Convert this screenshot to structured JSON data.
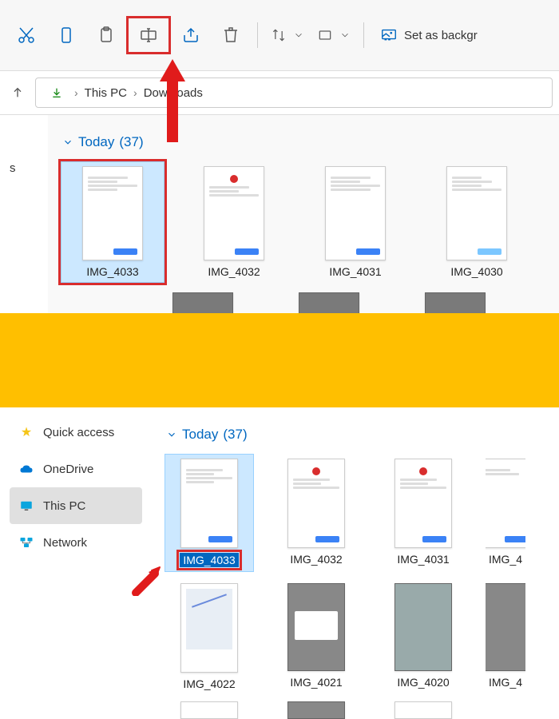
{
  "toolbar": {
    "set_background": "Set as backgr"
  },
  "breadcrumb": {
    "parts": [
      "This PC",
      "Downloads"
    ]
  },
  "group_header_top": {
    "label": "Today",
    "count": "(37)"
  },
  "files_top": [
    {
      "name": "IMG_4033"
    },
    {
      "name": "IMG_4032"
    },
    {
      "name": "IMG_4031"
    },
    {
      "name": "IMG_4030"
    }
  ],
  "sidebar": {
    "quick": "Quick access",
    "onedrive": "OneDrive",
    "thispc": "This PC",
    "network": "Network"
  },
  "group_header_bottom": {
    "label": "Today",
    "count": "(37)"
  },
  "files_bottom_r1": [
    {
      "name": "IMG_4033"
    },
    {
      "name": "IMG_4032"
    },
    {
      "name": "IMG_4031"
    },
    {
      "name": "IMG_4"
    }
  ],
  "files_bottom_r2": [
    {
      "name": "IMG_4022"
    },
    {
      "name": "IMG_4021"
    },
    {
      "name": "IMG_4020"
    },
    {
      "name": "IMG_4"
    }
  ],
  "sidebar_top": {
    "truncated": "s"
  }
}
